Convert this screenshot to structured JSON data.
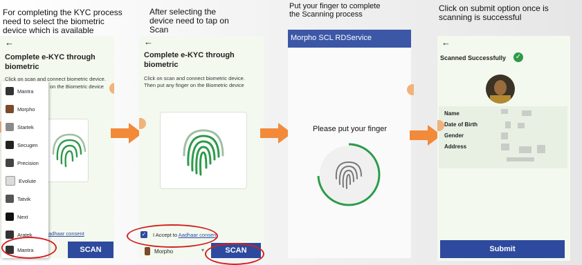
{
  "captions": {
    "step1": "For completing the KYC process\nneed to select the biometric\ndevice which is available",
    "step2": "After selecting the\ndevice need to tap on\nScan",
    "step3": "Put your finger to complete\nthe Scanning process",
    "step4": "Click on submit option once is\nscanning is successful"
  },
  "screen1": {
    "back_icon": "arrow-left-icon",
    "title": "Complete e-KYC through\nbiometric",
    "desc_line1": "Click on scan and connect biometric device.",
    "desc_line2": "on the Biometric device",
    "consent_link": "adhaar consent",
    "scan_label": "SCAN",
    "menu_items": [
      {
        "label": "Mantra"
      },
      {
        "label": "Morpho"
      },
      {
        "label": "Startek"
      },
      {
        "label": "Secugen"
      },
      {
        "label": "Precision"
      },
      {
        "label": "Evolute"
      },
      {
        "label": "Tatvik"
      },
      {
        "label": "Next"
      },
      {
        "label": "Aratek"
      },
      {
        "label": "Mantra"
      }
    ]
  },
  "screen2": {
    "back_icon": "arrow-left-icon",
    "title": "Complete e-KYC through\nbiometric",
    "desc_line1": "Click on scan and connect biometric device.",
    "desc_line2": "Then put any finger on the Biometric device",
    "accept_text": "I Accept to ",
    "accept_link": "Aadhaar consent",
    "device_selected": "Morpho",
    "scan_label": "SCAN"
  },
  "screen3": {
    "header": "Morpho SCL RDService",
    "prompt": "Please put your finger",
    "header_color": "#3b57a6"
  },
  "screen4": {
    "back_icon": "arrow-left-icon",
    "status": "Scanned Successfully",
    "fields": {
      "name": "Name",
      "dob": "Date of Birth",
      "gender": "Gender",
      "address": "Address"
    },
    "submit_label": "Submit"
  },
  "colors": {
    "phone_bg": "#f3f9ef",
    "button_blue": "#2e4a9e",
    "arrow_orange": "#f28a3a",
    "highlight_red": "#d42020",
    "success_green": "#2e9a4a"
  }
}
